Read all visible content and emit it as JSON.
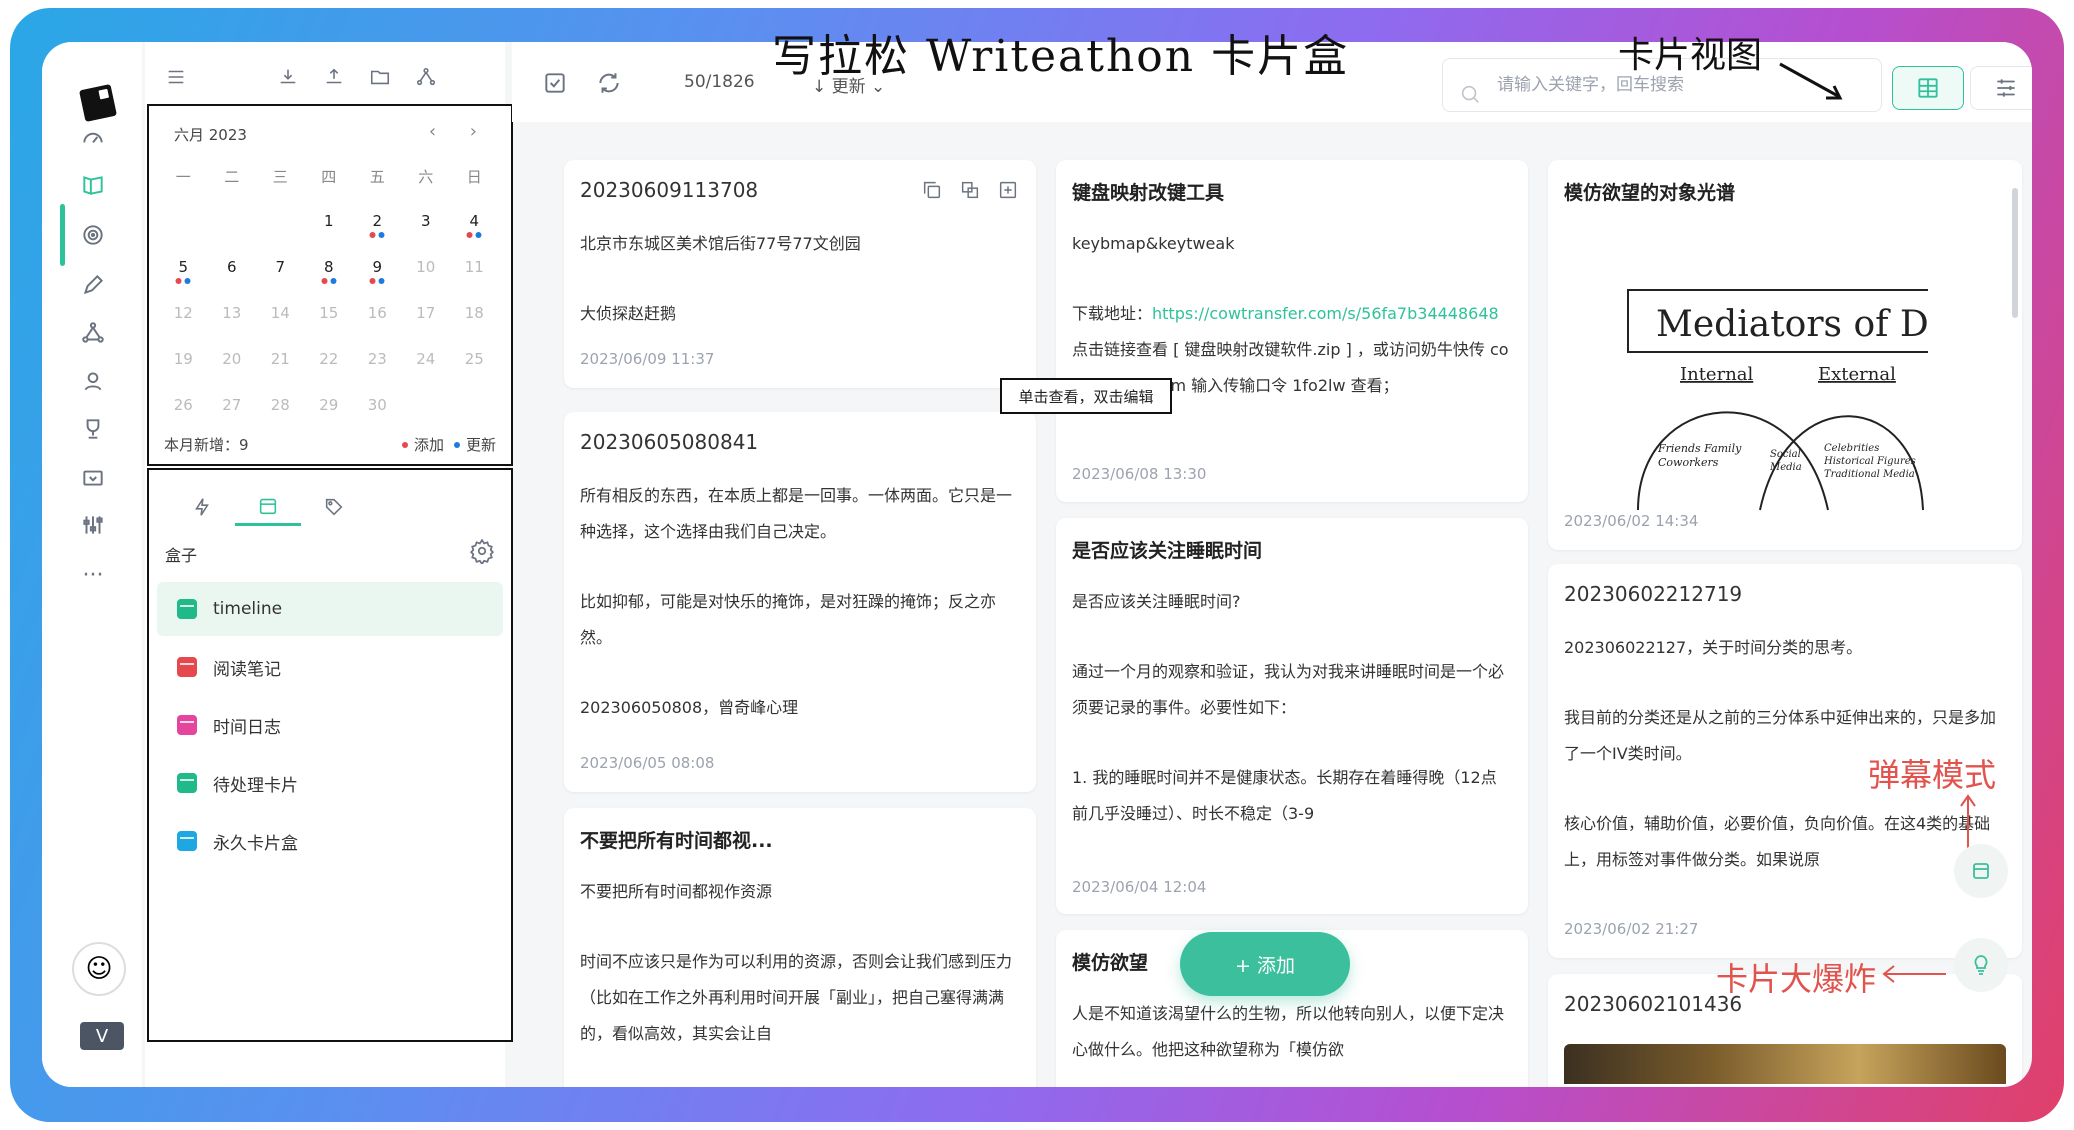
{
  "annotations": {
    "title": "写拉松 Writeathon 卡片盒",
    "card_view": "卡片视图",
    "danmaku_mode": "弹幕模式",
    "card_explode": "卡片大爆炸"
  },
  "calendar": {
    "month_label": "六月 2023",
    "weekdays": [
      "一",
      "二",
      "三",
      "四",
      "五",
      "六",
      "日"
    ],
    "weeks": [
      [
        "",
        "",
        "",
        "1",
        "2",
        "3",
        "4"
      ],
      [
        "5",
        "6",
        "7",
        "8",
        "9",
        "10",
        "11"
      ],
      [
        "12",
        "13",
        "14",
        "15",
        "16",
        "17",
        "18"
      ],
      [
        "19",
        "20",
        "21",
        "22",
        "23",
        "24",
        "25"
      ],
      [
        "26",
        "27",
        "28",
        "29",
        "30",
        "",
        ""
      ]
    ],
    "monthly_new": "本月新增：9",
    "legend_add": "添加",
    "legend_update": "更新",
    "colors": {
      "add": "#e5484d",
      "update": "#1f7ae0"
    }
  },
  "boxes": {
    "title": "盒子",
    "items": [
      {
        "label": "timeline",
        "color": "#20b98a"
      },
      {
        "label": "阅读笔记",
        "color": "#e5484d"
      },
      {
        "label": "时间日志",
        "color": "#e6459e"
      },
      {
        "label": "待处理卡片",
        "color": "#20b98a"
      },
      {
        "label": "永久卡片盒",
        "color": "#1ea7e1"
      }
    ]
  },
  "topbar": {
    "count": "50/1826",
    "sort_label": "↓ 更新",
    "search_placeholder": "请输入关键字，回车搜索"
  },
  "cards": {
    "c1": {
      "title": "20230609113708",
      "lines": [
        "北京市东城区美术馆后街77号77文创园",
        "大侦探赵赶鹅"
      ],
      "date": "2023/06/09 11:37"
    },
    "c2": {
      "title": "20230605080841",
      "p1": "所有相反的东西，在本质上都是一回事。一体两面。它只是一种选择，这个选择由我们自己决定。",
      "p2": "比如抑郁，可能是对快乐的掩饰，是对狂躁的掩饰；反之亦然。",
      "p3": "202306050808，曾奇峰心理",
      "date": "2023/06/05 08:08"
    },
    "c3": {
      "title": "不要把所有时间都视...",
      "p1": "不要把所有时间都视作资源",
      "p2": "时间不应该只是作为可以利用的资源，否则会让我们感到压力（比如在工作之外再利用时间开展「副业」，把自己塞得满满的，看似高效，其实会让自"
    },
    "c4": {
      "title": "键盘映射改键工具",
      "p1": "keybmap&keytweak",
      "p2a": "下载地址：",
      "link": "https://cowtransfer.com/s/56fa7b34448648",
      "p2b": " 点击链接查看 [ 键盘映射改键软件.zip ] ，或访问奶牛快传 cowtransfer.com 输入传输口令 1fo2lw 查看；",
      "date": "2023/06/08 13:30"
    },
    "c5": {
      "title": "是否应该关注睡眠时间",
      "p1": "是否应该关注睡眠时间?",
      "p2": "通过一个月的观察和验证，我认为对我来讲睡眠时间是一个必须要记录的事件。必要性如下：",
      "p3": "1.  我的睡眠时间并不是健康状态。长期存在着睡得晚（12点前几乎没睡过）、时长不稳定（3-9",
      "date": "2023/06/04 12:04"
    },
    "c6": {
      "title": "模仿欲望",
      "p1": "人是不知道该渴望什么的生物，所以他转向别人，以便下定决心做什么。他把这种欲望称为「模仿欲"
    },
    "c7": {
      "title": "模仿欲望的对象光谱",
      "date": "2023/06/02 14:34",
      "sketch": {
        "heading": "Mediators of Desire",
        "internal": "Internal",
        "external": "External",
        "left": "Friends Family Coworkers",
        "mid": "Social Media",
        "right": "Celebrities Historical Figures Traditional Media"
      }
    },
    "c8": {
      "title": "20230602212719",
      "p1": "202306022127，关于时间分类的思考。",
      "p2": "我目前的分类还是从之前的三分体系中延伸出来的，只是多加了一个IV类时间。",
      "p3": "核心价值，辅助价值，必要价值，负向价值。在这4类的基础上，用标签对事件做分类。如果说原",
      "date": "2023/06/02 21:27"
    },
    "c9": {
      "title": "20230602101436"
    }
  },
  "tooltip": "单击查看，双击编辑",
  "add_button": "+  添加",
  "avatar_label": "V"
}
